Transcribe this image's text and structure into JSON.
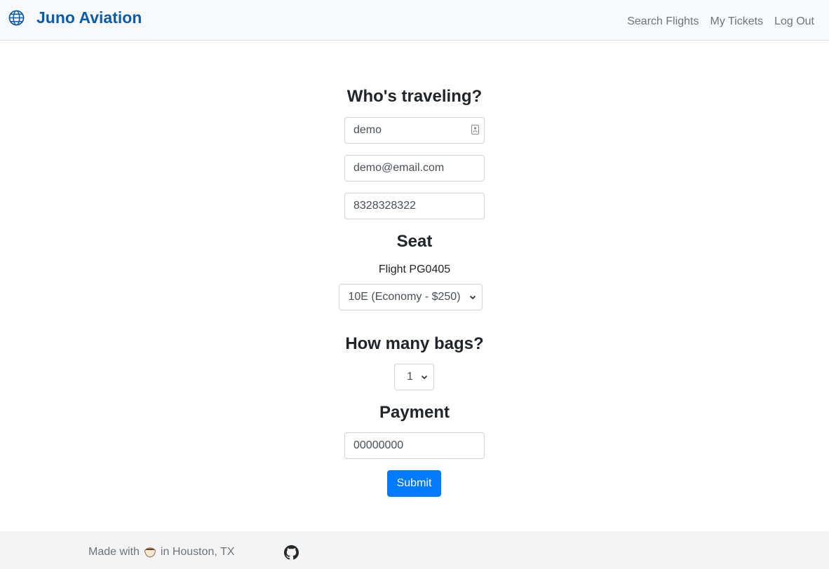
{
  "header": {
    "brand": "Juno Aviation",
    "brand_icon": "globe-icon",
    "brand_color": "#0b5cad",
    "nav": [
      "Search Flights",
      "My Tickets",
      "Log Out"
    ]
  },
  "traveler": {
    "heading": "Who's traveling?",
    "name": "demo",
    "email": "demo@email.com",
    "phone": "8328328322"
  },
  "seat": {
    "heading": "Seat",
    "flight": "Flight PG0405",
    "selected": "10E (Economy - $250)"
  },
  "bags": {
    "heading": "How many bags?",
    "selected": "1"
  },
  "payment": {
    "heading": "Payment",
    "card": "00000000",
    "submit_label": "Submit",
    "submit_color": "#007bff"
  },
  "footer": {
    "made_with": "Made with",
    "location": "in Houston, TX",
    "icons": [
      "coffee-icon",
      "github-icon"
    ]
  }
}
